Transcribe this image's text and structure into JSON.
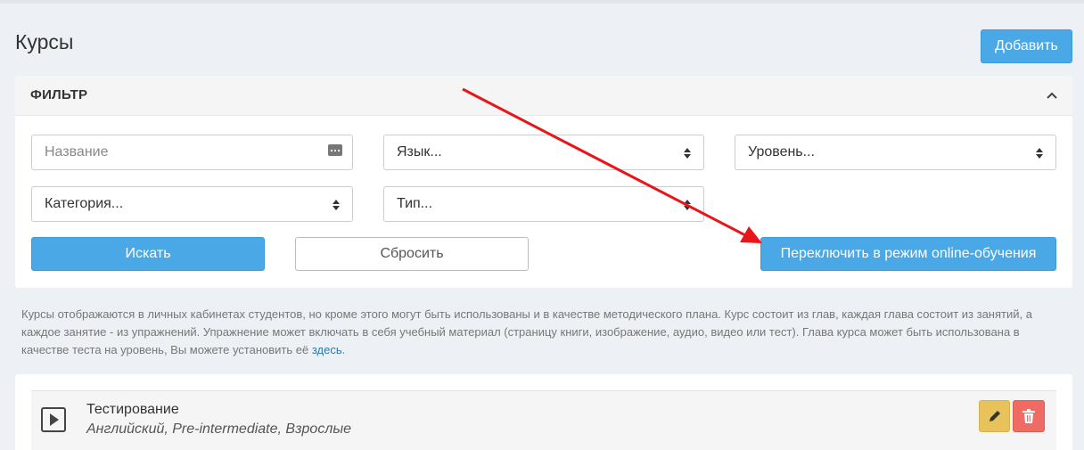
{
  "page": {
    "title": "Курсы",
    "add_label": "Добавить"
  },
  "filter": {
    "title": "ФИЛЬТР",
    "name_placeholder": "Название",
    "language": "Язык...",
    "level": "Уровень...",
    "category": "Категория...",
    "type": "Тип...",
    "search_label": "Искать",
    "reset_label": "Сбросить",
    "online_label": "Переключить в режим online-обучения"
  },
  "info": {
    "text": "Курсы отображаются в личных кабинетах студентов, но кроме этого могут быть использованы и в качестве методического плана. Курс состоит из глав, каждая глава состоит из занятий, а каждое занятие - из упражнений. Упражнение может включать в себя учебный материал (страницу книги, изображение, аудио, видео или тест). Глава курса может быть использована в качестве теста на уровень, Вы можете установить её ",
    "link": "здесь",
    "end": "."
  },
  "courses": [
    {
      "title": "Тестирование",
      "subtitle": "Английский, Pre-intermediate, Взрослые"
    }
  ],
  "icons": {
    "collapse": "chevron-up-icon",
    "keyboard": "keyboard-icon",
    "select": "sort-icon",
    "play": "play-icon",
    "edit": "pencil-icon",
    "delete": "trash-icon"
  },
  "colors": {
    "primary": "#4aa8e6",
    "edit": "#e8c25a",
    "delete": "#f06b63",
    "annotation_arrow": "#e8161b"
  }
}
